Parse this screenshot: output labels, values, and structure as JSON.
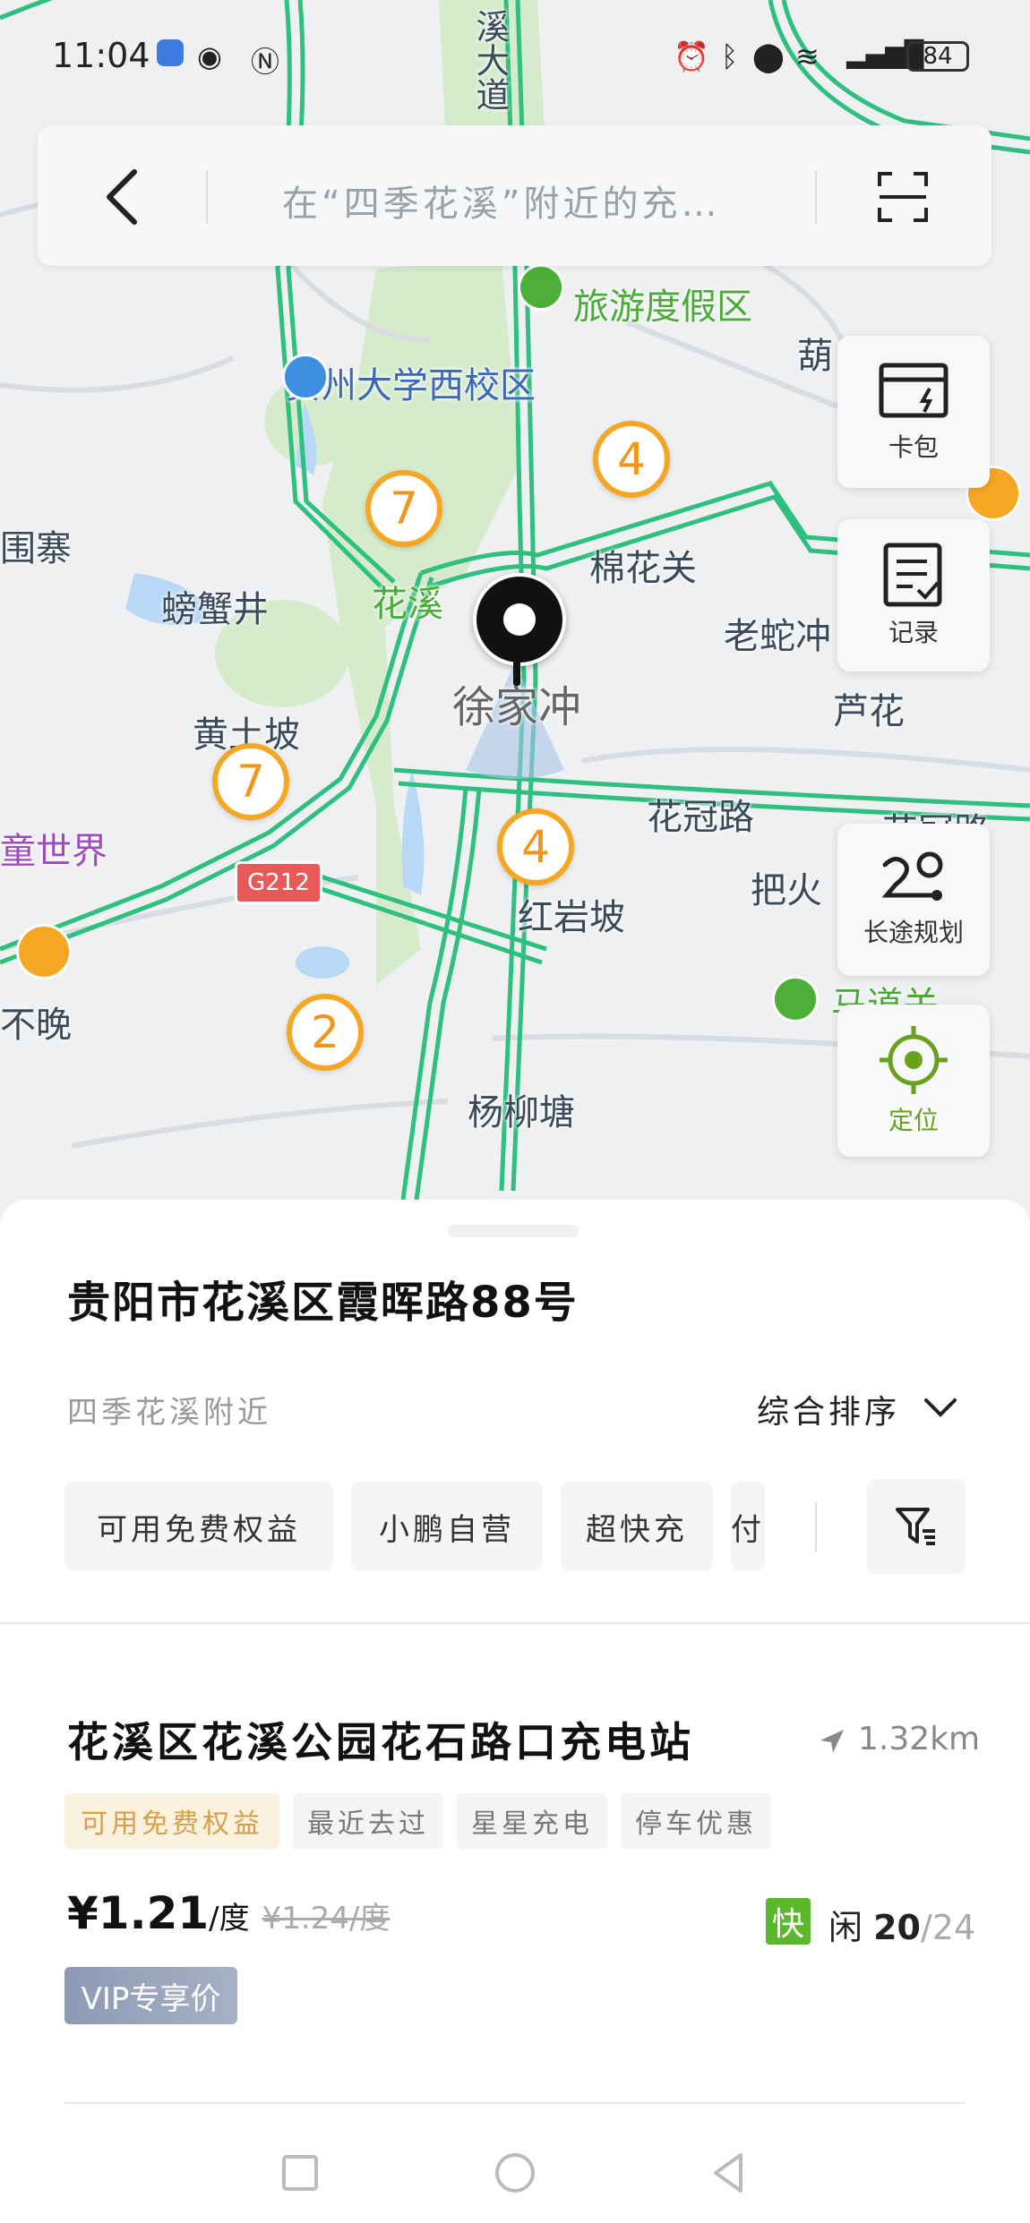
{
  "status_bar": {
    "time": "11:04",
    "battery": "84",
    "icons": [
      "voice-icon",
      "eye-icon",
      "nfc-icon",
      "alarm-icon",
      "bluetooth-icon",
      "location-icon",
      "wifi-icon",
      "4g-signal-icon"
    ]
  },
  "search": {
    "placeholder": "在“四季花溪”附近的充…"
  },
  "map": {
    "labels": [
      {
        "text": "贵州大学西校区",
        "style": "blue"
      },
      {
        "text": "旅游度假区",
        "style": "green"
      },
      {
        "text": "棉花关",
        "style": "normal"
      },
      {
        "text": "花溪",
        "style": "green"
      },
      {
        "text": "徐家冲",
        "style": "normal"
      },
      {
        "text": "老蛇冲",
        "style": "normal"
      },
      {
        "text": "芦花",
        "style": "normal"
      },
      {
        "text": "螃蟹井",
        "style": "normal"
      },
      {
        "text": "围寨",
        "style": "normal"
      },
      {
        "text": "黄土坡",
        "style": "normal"
      },
      {
        "text": "童世界",
        "style": "purple"
      },
      {
        "text": "花冠路",
        "style": "normal"
      },
      {
        "text": "花冠路",
        "style": "normal"
      },
      {
        "text": "把火",
        "style": "normal"
      },
      {
        "text": "红岩坡",
        "style": "normal"
      },
      {
        "text": "马道关",
        "style": "green"
      },
      {
        "text": "杨柳塘",
        "style": "normal"
      },
      {
        "text": "不晚",
        "style": "normal"
      },
      {
        "text": "葫",
        "style": "normal"
      },
      {
        "text": "溪大道",
        "style": "normal"
      },
      {
        "text": "G212",
        "style": "road"
      }
    ],
    "clusters": [
      "4",
      "7",
      "7",
      "4",
      "2"
    ]
  },
  "side_buttons": {
    "card_pack": "卡包",
    "records": "记录",
    "route_plan": "长途规划",
    "locate": "定位"
  },
  "sheet": {
    "address": "贵阳市花溪区霞晖路88号",
    "nearby": "四季花溪附近",
    "sort_label": "综合排序",
    "filter_chips": [
      "可用免费权益",
      "小鹏自营",
      "超快充",
      "付"
    ]
  },
  "station": {
    "name": "花溪区花溪公园花石路口充电站",
    "distance": "1.32km",
    "tags": [
      "可用免费权益",
      "最近去过",
      "星星充电",
      "停车优惠"
    ],
    "price": "¥1.21",
    "price_unit": "/度",
    "old_price": "¥1.24/度",
    "fast_label": "快",
    "idle_label": "闲",
    "idle_count": "20",
    "total_count": "/24",
    "vip_label": "VIP专享价"
  },
  "colors": {
    "road_green": "#2fbf7f",
    "cluster_orange": "#f5a623",
    "accent_green": "#6aa01a",
    "fast_green": "#5ab82a"
  }
}
